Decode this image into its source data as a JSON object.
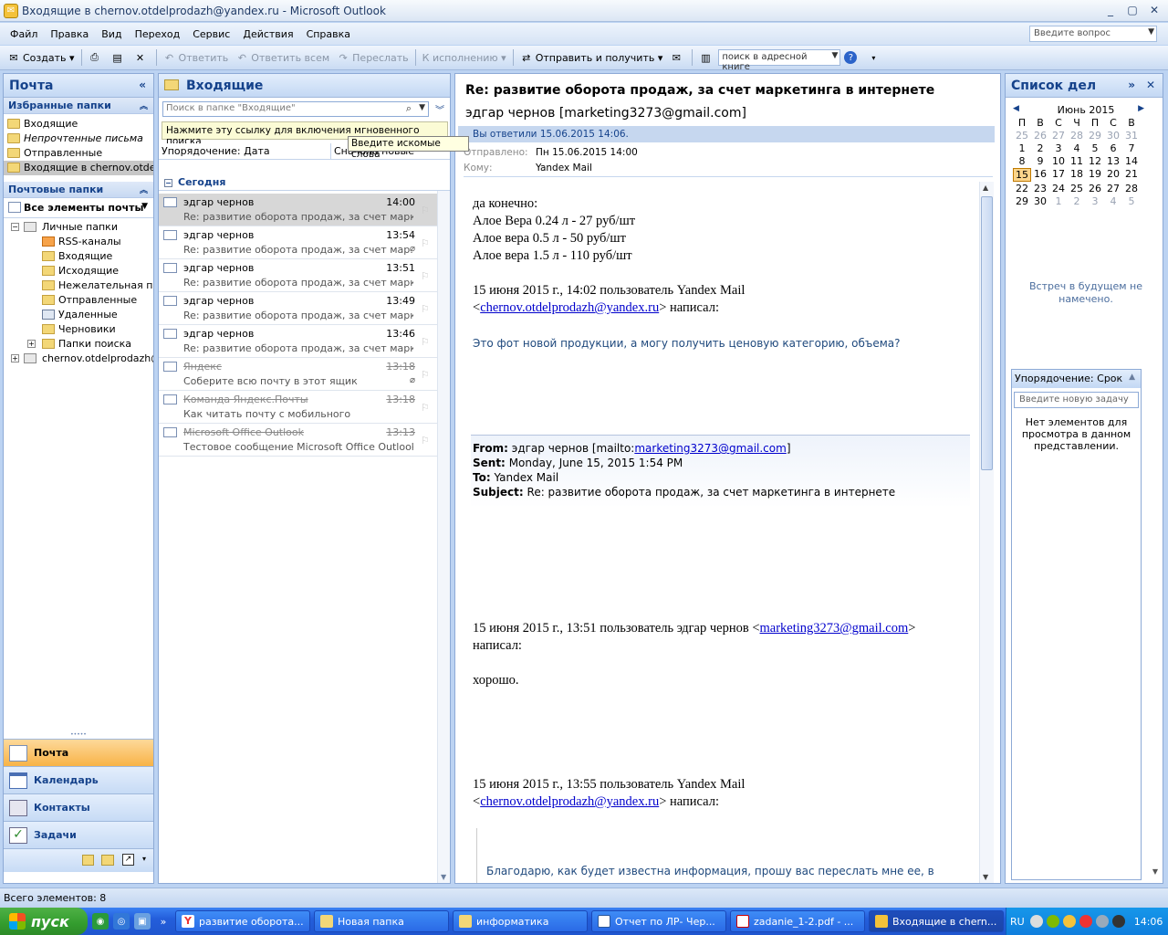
{
  "window": {
    "title": "Входящие в chernov.otdelprodazh@yandex.ru - Microsoft Outlook"
  },
  "menu": [
    "Файл",
    "Правка",
    "Вид",
    "Переход",
    "Сервис",
    "Действия",
    "Справка"
  ],
  "ask_placeholder": "Введите вопрос",
  "toolbar": {
    "create": "Создать",
    "reply": "Ответить",
    "reply_all": "Ответить всем",
    "forward": "Переслать",
    "followup": "К исполнению",
    "send_receive": "Отправить и получить",
    "addr_search": "поиск в адресной книге"
  },
  "nav": {
    "title": "Почта",
    "favorites_title": "Избранные папки",
    "favorites": [
      "Входящие",
      "Непрочтенные письма",
      "Отправленные",
      "Входящие в chernov.otdelprodazh@yandex.ru"
    ],
    "mailfolders_title": "Почтовые папки",
    "all_items": "Все элементы почты",
    "tree": {
      "personal": "Личные папки",
      "children": [
        "RSS-каналы",
        "Входящие",
        "Исходящие",
        "Нежелательная почта",
        "Отправленные",
        "Удаленные",
        "Черновики",
        "Папки поиска"
      ],
      "account": "chernov.otdelprodazh@yandex.ru"
    },
    "buttons": [
      "Почта",
      "Календарь",
      "Контакты",
      "Задачи"
    ]
  },
  "list": {
    "title": "Входящие",
    "search_placeholder": "Поиск в папке \"Входящие\"",
    "hint": "Нажмите эту ссылку для включения мгновенного поиска",
    "tooltip": "Введите искомые слова",
    "sort_by": "Упорядочение: Дата",
    "sort_order": "Сначала новые",
    "group": "Сегодня",
    "messages": [
      {
        "from": "эдгар чернов",
        "time": "14:00",
        "subject": "Re: развитие оборота продаж, за счет марке...",
        "read": false,
        "selected": true,
        "attach": false
      },
      {
        "from": "эдгар чернов",
        "time": "13:54",
        "subject": "Re: развитие оборота продаж, за счет мар...",
        "read": false,
        "selected": false,
        "attach": true
      },
      {
        "from": "эдгар чернов",
        "time": "13:51",
        "subject": "Re: развитие оборота продаж, за счет марке...",
        "read": false,
        "selected": false,
        "attach": false
      },
      {
        "from": "эдгар чернов",
        "time": "13:49",
        "subject": "Re: развитие оборота продаж, за счет марке...",
        "read": false,
        "selected": false,
        "attach": false
      },
      {
        "from": "эдгар чернов",
        "time": "13:46",
        "subject": "Re: развитие оборота продаж, за счет марке...",
        "read": false,
        "selected": false,
        "attach": false
      },
      {
        "from": "Яндекс",
        "time": "13:18",
        "subject": "Соберите всю почту в этот ящик",
        "read": true,
        "selected": false,
        "attach": true
      },
      {
        "from": "Команда Яндекс.Почты",
        "time": "13:18",
        "subject": "Как читать почту с мобильного",
        "read": true,
        "selected": false,
        "attach": false
      },
      {
        "from": "Microsoft Office Outlook",
        "time": "13:13",
        "subject": "Тестовое сообщение Microsoft Office Outlook",
        "read": true,
        "selected": false,
        "attach": false
      }
    ]
  },
  "reading": {
    "subject": "Re: развитие оборота продаж, за счет маркетинга в интернете",
    "from": "эдгар чернов [marketing3273@gmail.com]",
    "info": "Вы ответили 15.06.2015 14:06.",
    "sent_label": "Отправлено:",
    "sent": "Пн 15.06.2015 14:00",
    "to_label": "Кому:",
    "to": "Yandex Mail",
    "body": {
      "l1": "да конечно:",
      "l2": "Алое Вера 0.24 л - 27 руб/шт",
      "l3": "Алое вера 0.5 л - 50 руб/шт",
      "l4": "Алое вера 1.5 л - 110 руб/шт",
      "q1a": "15 июня 2015 г., 14:02 пользователь Yandex Mail",
      "q1b_pre": "<",
      "q1b_link": "chernov.otdelprodazh@yandex.ru",
      "q1b_post": "> написал:",
      "q1_text": "Это фот новой продукции, а могу получить ценовую категорию, объема?",
      "fwd_from_label": "From:",
      "fwd_from": "эдгар чернов [mailto:",
      "fwd_from_link": "marketing3273@gmail.com",
      "fwd_from_end": "]",
      "fwd_sent_label": "Sent:",
      "fwd_sent": "Monday, June 15, 2015 1:54 PM",
      "fwd_to_label": "To:",
      "fwd_to": "Yandex Mail",
      "fwd_subject_label": "Subject:",
      "fwd_subject": "Re: развитие оборота продаж, за счет маркетинга в интернете",
      "q2a": "15 июня 2015 г., 13:51 пользователь эдгар чернов <",
      "q2a_link": "marketing3273@gmail.com",
      "q2a_end": ">",
      "q2b": "написал:",
      "q2_text": "хорошо.",
      "q3a": "15 июня 2015 г., 13:55 пользователь Yandex Mail",
      "q3b_pre": "<",
      "q3b_link": "chernov.otdelprodazh@yandex.ru",
      "q3b_post": "> написал:",
      "q3_text": "Благодарю, как будет известна информация, прошу вас переслать мне ее, в"
    }
  },
  "todo": {
    "title": "Список дел",
    "month": "Июнь 2015",
    "weekdays": [
      "П",
      "В",
      "С",
      "Ч",
      "П",
      "С",
      "В"
    ],
    "days": [
      [
        "25",
        "26",
        "27",
        "28",
        "29",
        "30",
        "31"
      ],
      [
        "1",
        "2",
        "3",
        "4",
        "5",
        "6",
        "7"
      ],
      [
        "8",
        "9",
        "10",
        "11",
        "12",
        "13",
        "14"
      ],
      [
        "15",
        "16",
        "17",
        "18",
        "19",
        "20",
        "21"
      ],
      [
        "22",
        "23",
        "24",
        "25",
        "26",
        "27",
        "28"
      ],
      [
        "29",
        "30",
        "1",
        "2",
        "3",
        "4",
        "5"
      ]
    ],
    "appointments": "Встреч в будущем не намечено.",
    "task_sort": "Упорядочение: Срок",
    "task_input": "Введите новую задачу",
    "task_none": "Нет элементов для просмотра в данном представлении."
  },
  "status": "Всего элементов: 8",
  "taskbar": {
    "start": "пуск",
    "tasks": [
      "развитие оборота...",
      "Новая папка",
      "информатика",
      "Отчет по ЛР- Чер...",
      "zadanie_1-2.pdf - ...",
      "Входящие в chern..."
    ],
    "lang": "RU",
    "clock": "14:06"
  }
}
